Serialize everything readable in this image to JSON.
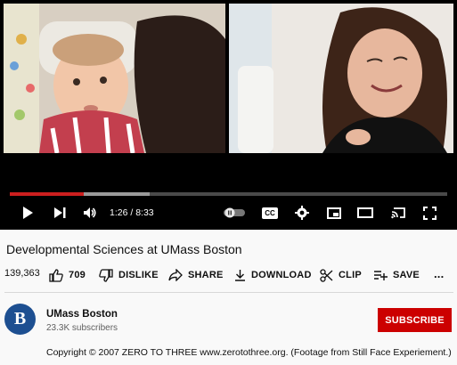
{
  "player": {
    "time": "1:26 / 8:33",
    "progress_played": 0.17,
    "progress_buffered": 0.32,
    "controls": [
      "play-icon",
      "next-icon",
      "volume-icon",
      "autoplay-toggle",
      "captions-icon",
      "settings-icon",
      "miniplayer-icon",
      "theater-icon",
      "cast-icon",
      "fullscreen-icon"
    ],
    "captions_label": "CC"
  },
  "video": {
    "title": "Developmental Sciences at UMass Boston",
    "views": "139,363"
  },
  "actions": {
    "like_count": "709",
    "dislike_label": "DISLIKE",
    "share_label": "SHARE",
    "download_label": "DOWNLOAD",
    "clip_label": "CLIP",
    "save_label": "SAVE",
    "more_label": "..."
  },
  "channel": {
    "avatar_text": "B",
    "name": "UMass Boston",
    "subscribers": "23.3K subscribers",
    "subscribe_label": "SUBSCRIBE"
  },
  "description": {
    "text": "Copyright © 2007 ZERO TO THREE www.zerotothree.org. (Footage from Still Face Experiement.)"
  },
  "colors": {
    "accent_red": "#cc0000",
    "channel_blue": "#1d4f91"
  }
}
